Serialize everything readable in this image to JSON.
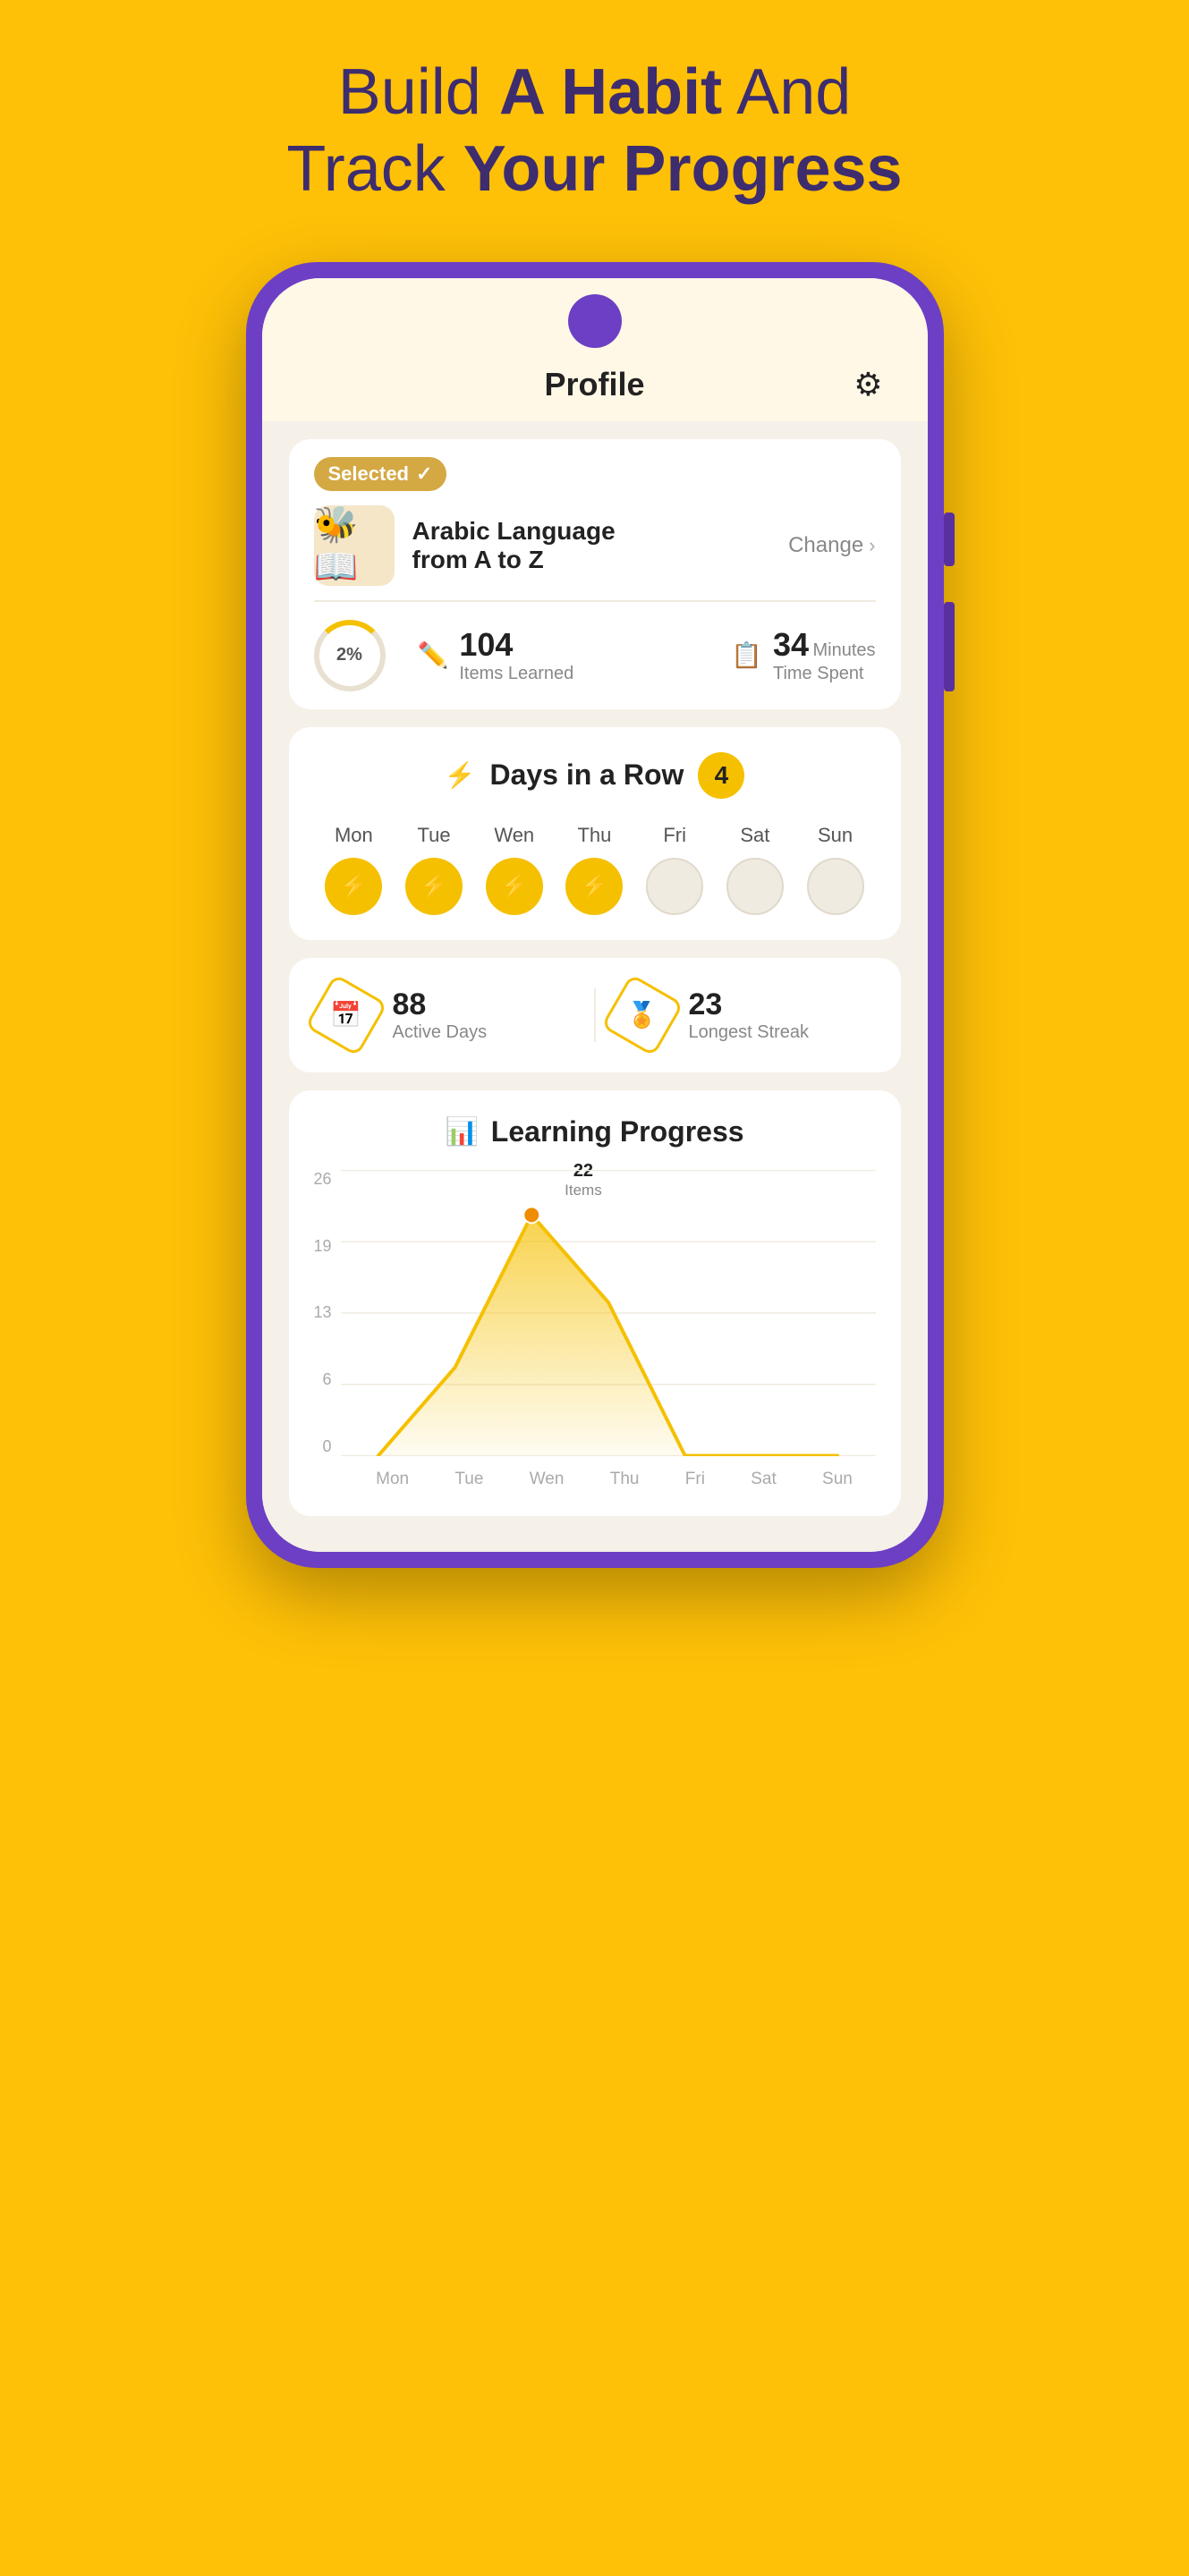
{
  "hero": {
    "line1": "Build ",
    "line1_bold": "A Habit",
    "line1_rest": " And",
    "line2": "Track ",
    "line2_bold": "Your Progress"
  },
  "header": {
    "title": "Profile"
  },
  "course": {
    "badge": "Selected",
    "badge_check": "✓",
    "name_line1": "Arabic Language",
    "name_line2": "from A to Z",
    "change_label": "Change",
    "emoji": "🐝",
    "progress_percent": "2%",
    "items_learned": "104",
    "items_label": "Items Learned",
    "time_spent": "34",
    "time_unit": "Minutes",
    "time_label": "Time Spent"
  },
  "days_in_row": {
    "lightning": "⚡",
    "title": "Days in a Row",
    "count": "4",
    "days": [
      {
        "label": "Mon",
        "active": true
      },
      {
        "label": "Tue",
        "active": true
      },
      {
        "label": "Wen",
        "active": true
      },
      {
        "label": "Thu",
        "active": true
      },
      {
        "label": "Fri",
        "active": false
      },
      {
        "label": "Sat",
        "active": false
      },
      {
        "label": "Sun",
        "active": false
      }
    ]
  },
  "streak": {
    "active_days_number": "88",
    "active_days_label": "Active Days",
    "longest_streak_number": "23",
    "longest_streak_label": "Longest Streak"
  },
  "learning_progress": {
    "title": "Learning Progress",
    "tooltip_value": "22",
    "tooltip_label": "Items",
    "y_labels": [
      "26",
      "19",
      "13",
      "6",
      "0"
    ],
    "x_labels": [
      "Mon",
      "Tue",
      "Wen",
      "Thu",
      "Fri",
      "Sat",
      "Sun"
    ],
    "chart_data": [
      0,
      8,
      22,
      14,
      0,
      0,
      0
    ]
  }
}
